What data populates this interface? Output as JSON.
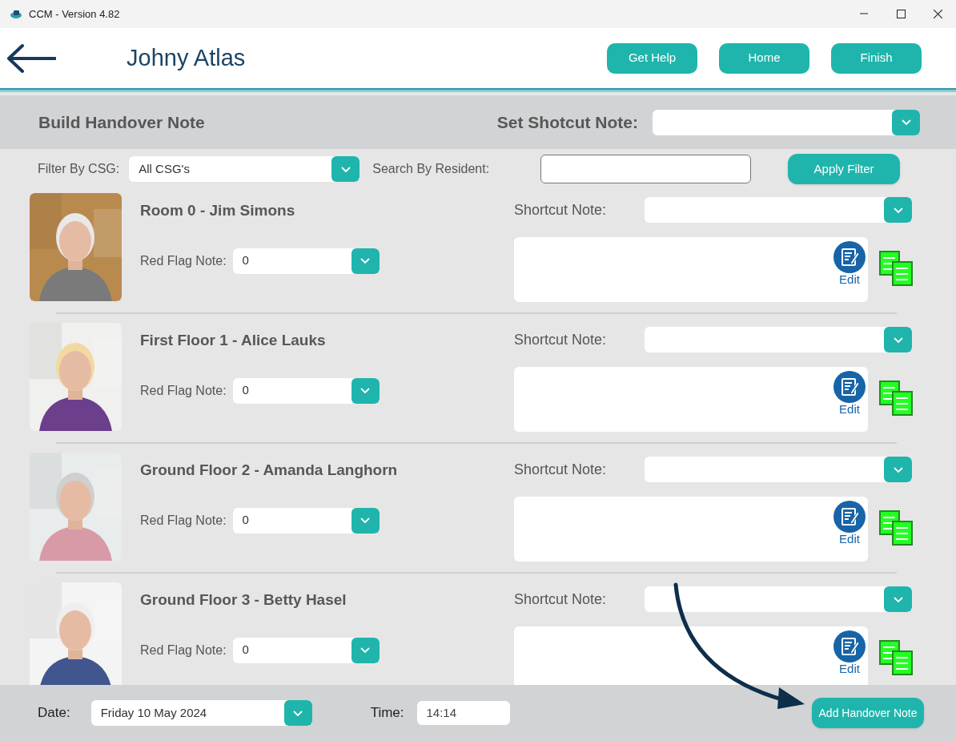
{
  "window": {
    "title": "CCM - Version 4.82"
  },
  "header": {
    "title": "Johny Atlas",
    "buttons": [
      "Get Help",
      "Home",
      "Finish"
    ]
  },
  "section": {
    "title": "Build Handover Note",
    "shortcut_label": "Set Shotcut Note:"
  },
  "filter": {
    "csg_label": "Filter By CSG:",
    "csg_value": "All CSG's",
    "search_label": "Search By Resident:",
    "apply_button": "Apply Filter"
  },
  "residents": [
    {
      "name": "Room 0 - Jim Simons",
      "red_flag_label": "Red Flag Note:",
      "red_flag_value": "0",
      "shortcut_label": "Shortcut Note:",
      "edit_label": "Edit"
    },
    {
      "name": "First Floor 1 - Alice Lauks",
      "red_flag_label": "Red Flag Note:",
      "red_flag_value": "0",
      "shortcut_label": "Shortcut Note:",
      "edit_label": "Edit"
    },
    {
      "name": "Ground Floor 2 - Amanda Langhorn",
      "red_flag_label": "Red Flag Note:",
      "red_flag_value": "0",
      "shortcut_label": "Shortcut Note:",
      "edit_label": "Edit"
    },
    {
      "name": "Ground Floor 3 - Betty Hasel",
      "red_flag_label": "Red Flag Note:",
      "red_flag_value": "0",
      "shortcut_label": "Shortcut Note:",
      "edit_label": "Edit"
    }
  ],
  "footer": {
    "date_label": "Date:",
    "date_value": "Friday 10 May 2024",
    "time_label": "Time:",
    "time_value": "14:14",
    "add_button": "Add Handover Note"
  }
}
